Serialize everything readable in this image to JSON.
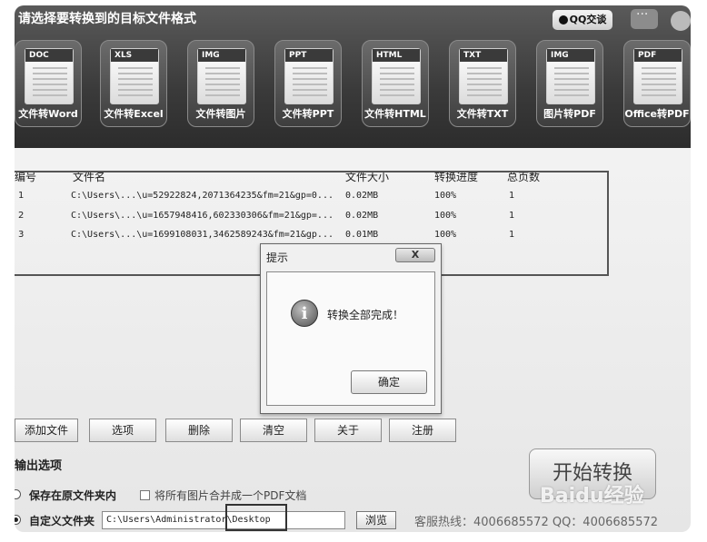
{
  "header": {
    "title": "请选择要转换到的目标文件格式",
    "qq_label": "QQ交谈",
    "tiles": [
      {
        "tag": "DOC",
        "label": "文件转Word"
      },
      {
        "tag": "XLS",
        "label": "文件转Excel"
      },
      {
        "tag": "IMG",
        "label": "文件转图片"
      },
      {
        "tag": "PPT",
        "label": "文件转PPT"
      },
      {
        "tag": "HTML",
        "label": "文件转HTML"
      },
      {
        "tag": "TXT",
        "label": "文件转TXT"
      },
      {
        "tag": "IMG",
        "label": "图片转PDF"
      },
      {
        "tag": "PDF",
        "label": "Office转PDF"
      }
    ]
  },
  "table": {
    "columns": [
      "编号",
      "文件名",
      "文件大小",
      "转换进度",
      "总页数"
    ],
    "rows": [
      {
        "id": "1",
        "name": "C:\\Users\\...\\u=52922824,2071364235&fm=21&gp=0...",
        "size": "0.02MB",
        "progress": "100%",
        "pages": "1"
      },
      {
        "id": "2",
        "name": "C:\\Users\\...\\u=1657948416,602330306&fm=21&gp=...",
        "size": "0.02MB",
        "progress": "100%",
        "pages": "1"
      },
      {
        "id": "3",
        "name": "C:\\Users\\...\\u=1699108031,3462589243&fm=21&gp...",
        "size": "0.01MB",
        "progress": "100%",
        "pages": "1"
      }
    ]
  },
  "dialog": {
    "title": "提示",
    "close_label": "X",
    "message": "转换全部完成！",
    "ok_label": "确定"
  },
  "toolbar": {
    "add_file": "添加文件",
    "options": "选项",
    "delete": "删除",
    "clear": "清空",
    "about": "关于",
    "register": "注册"
  },
  "output": {
    "section_title": "输出选项",
    "save_in_source": "保存在原文件夹内",
    "merge_pdf": "将所有图片合并成一个PDF文档",
    "custom_folder": "自定义文件夹",
    "path_value": "C:\\Users\\Administrator\\Desktop",
    "browse_label": "浏览",
    "hotline": "客服热线：4006685572 QQ：4006685572"
  },
  "start_button": "开始转换",
  "watermark": "Baidu经验"
}
